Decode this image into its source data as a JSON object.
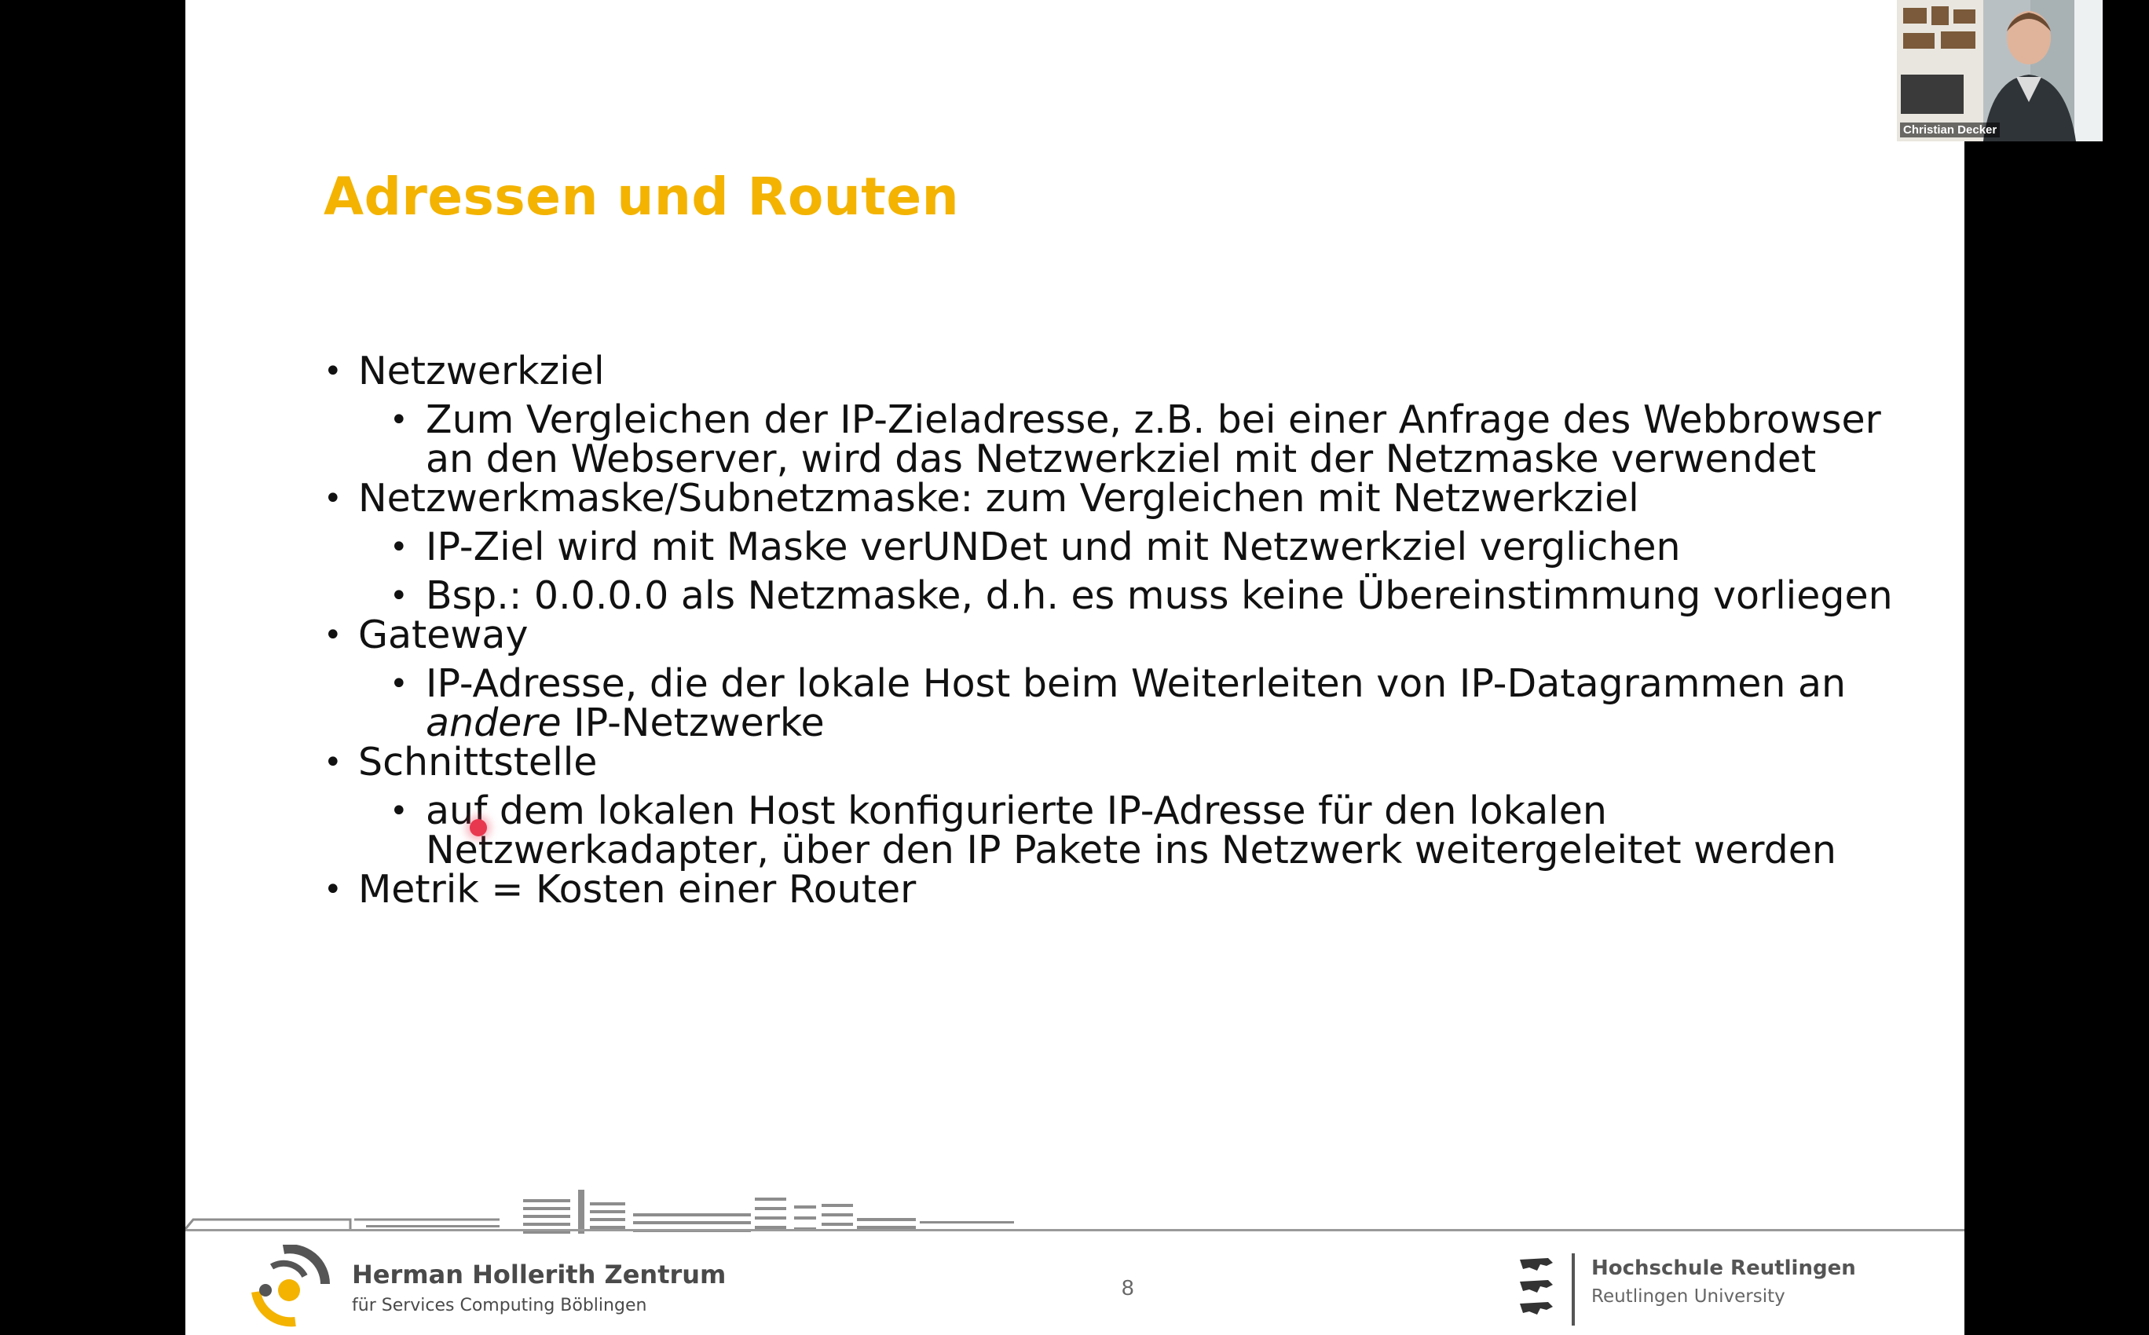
{
  "slide": {
    "title": "Adressen und Routen",
    "items": [
      {
        "text": "Netzwerkziel",
        "sub": [
          "Zum Vergleichen der IP-Zieladresse, z.B. bei einer Anfrage des Webbrowser an den Webserver, wird das Netzwerkziel mit der Netzmaske verwendet"
        ]
      },
      {
        "text": "Netzwerkmaske/Subnetzmaske: zum Vergleichen mit Netzwerkziel",
        "sub": [
          "IP-Ziel wird mit Maske verUNDet und mit Netzwerkziel verglichen",
          "Bsp.: 0.0.0.0 als Netzmaske, d.h. es muss keine Übereinstimmung vorliegen"
        ]
      },
      {
        "text": "Gateway",
        "sub_rich": {
          "before": "IP-Adresse, die der lokale Host beim Weiterleiten von IP-Datagrammen an ",
          "emph": "andere",
          "after": " IP-Netzwerke"
        }
      },
      {
        "text": "Schnittstelle",
        "sub": [
          "auf dem lokalen Host konfigurierte IP-Adresse für den lokalen Netzwerkadapter, über den IP Pakete ins Netzwerk weitergeleitet werden"
        ]
      },
      {
        "text": "Metrik = Kosten einer Router"
      }
    ],
    "bullet_glyph": "•",
    "page_number": "8",
    "title_color": "#f3b300"
  },
  "footer": {
    "org_name": "Herman Hollerith Zentrum",
    "org_sub": "für Services Computing Böblingen",
    "university_name": "Hochschule Reutlingen",
    "university_sub": "Reutlingen University"
  },
  "webcam": {
    "participant_name": "Christian Decker"
  },
  "icons": {
    "pointer": "laser-pointer-dot",
    "logo_left": "hhz-logo",
    "logo_right": "reutlingen-emblem"
  }
}
